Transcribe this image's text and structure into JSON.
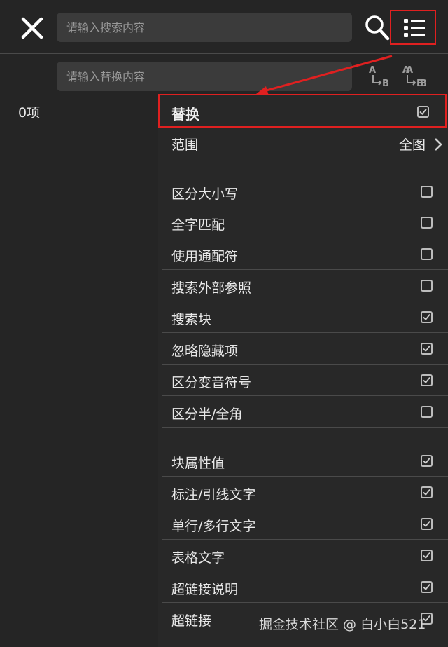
{
  "header": {
    "search_placeholder": "请输入搜索内容",
    "replace_placeholder": "请输入替换内容"
  },
  "result_count": "0项",
  "panel": {
    "replace": {
      "label": "替换",
      "checked": true
    },
    "scope": {
      "label": "范围",
      "value": "全图"
    },
    "options": [
      {
        "label": "区分大小写",
        "checked": false
      },
      {
        "label": "全字匹配",
        "checked": false
      },
      {
        "label": "使用通配符",
        "checked": false
      },
      {
        "label": "搜索外部参照",
        "checked": false
      },
      {
        "label": "搜索块",
        "checked": true
      },
      {
        "label": "忽略隐藏项",
        "checked": true
      },
      {
        "label": "区分变音符号",
        "checked": true
      },
      {
        "label": "区分半/全角",
        "checked": false
      }
    ],
    "targets": [
      {
        "label": "块属性值",
        "checked": true
      },
      {
        "label": "标注/引线文字",
        "checked": true
      },
      {
        "label": "单行/多行文字",
        "checked": true
      },
      {
        "label": "表格文字",
        "checked": true
      },
      {
        "label": "超链接说明",
        "checked": true
      },
      {
        "label": "超链接",
        "checked": true
      }
    ]
  },
  "watermark": "掘金技术社区 @ 白小白521",
  "colors": {
    "highlight": "#e02020",
    "background": "#252525",
    "input": "#3b3b3b"
  }
}
